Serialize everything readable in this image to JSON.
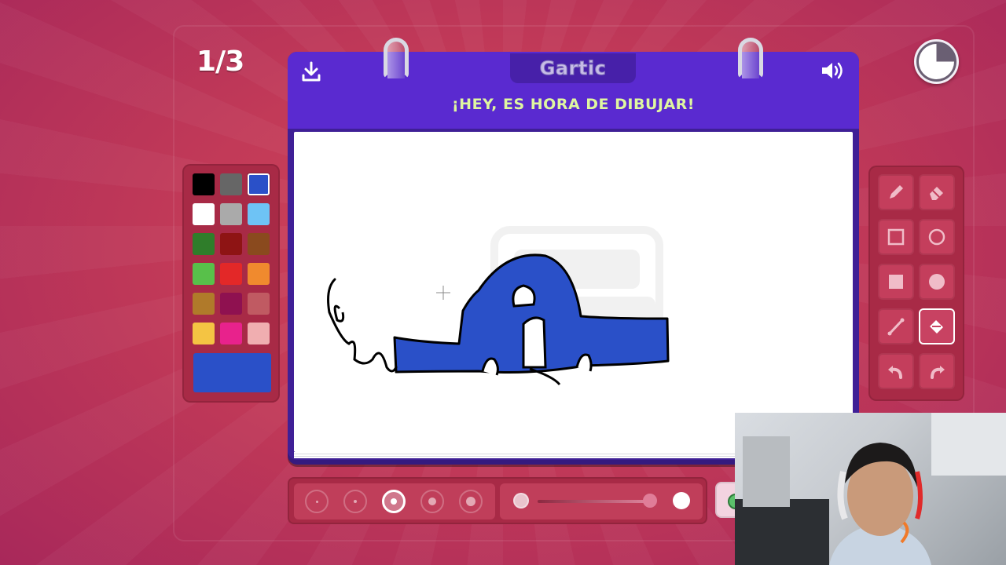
{
  "game": {
    "round_counter": "1/3",
    "logo": "Gartic",
    "header_title": "¡HEY, ES HORA DE DIBUJAR!",
    "timer_progress": 0.25
  },
  "palette": {
    "colors": [
      "#000000",
      "#666666",
      "#2a50c8",
      "#ffffff",
      "#aaaaaa",
      "#6ec3f5",
      "#2f7d2a",
      "#8e1414",
      "#8a4a1e",
      "#58c04a",
      "#e32828",
      "#f08a2e",
      "#b07a2a",
      "#8f1150",
      "#c05a62",
      "#f4c443",
      "#e8228c",
      "#f0aeb0"
    ],
    "selected_index": 2,
    "current_color": "#2a50c8"
  },
  "tools": {
    "items": [
      "pencil-icon",
      "eraser-icon",
      "rectangle-outline-icon",
      "circle-outline-icon",
      "rectangle-fill-icon",
      "circle-fill-icon",
      "line-icon",
      "bucket-fill-icon",
      "undo-icon",
      "redo-icon"
    ],
    "selected": "bucket-fill-icon"
  },
  "brush": {
    "sizes": 5,
    "selected_size_index": 2,
    "opacity": 0.95
  },
  "colors": {
    "background": "#c23a58",
    "notebook": "#3f1f96",
    "header": "#5a2ad0",
    "title": "#dff7a0",
    "panel": "#a82a46"
  }
}
